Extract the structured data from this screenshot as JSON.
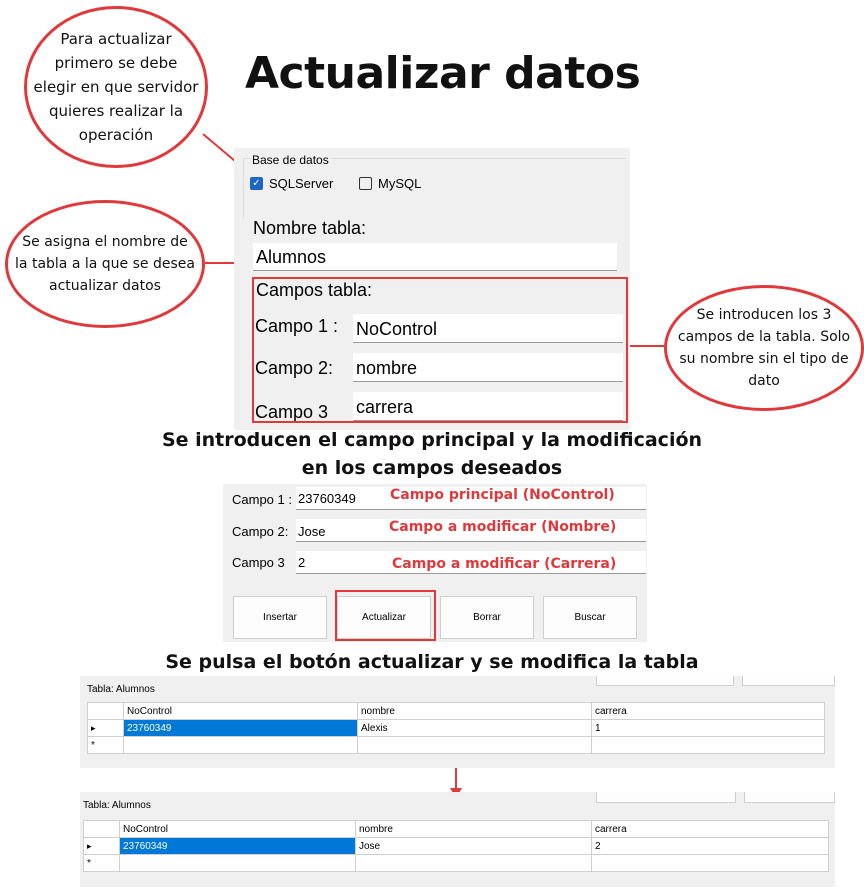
{
  "title": "Actualizar datos",
  "bubbles": {
    "server": "Para actualizar primero se debe elegir en que servidor quieres realizar la operación",
    "table": "Se asigna el nombre de la tabla a la que se desea actualizar datos",
    "fields": "Se introducen los 3 campos de la tabla. Solo su nombre sin el tipo de dato"
  },
  "form1": {
    "group_label": "Base de datos",
    "sqlserver": "SQLServer",
    "mysql": "MySQL",
    "nombre_tabla_label": "Nombre tabla:",
    "nombre_tabla_value": "Alumnos",
    "campos_label": "Campos tabla:",
    "campo1_label": "Campo 1 :",
    "campo1_value": "NoControl",
    "campo2_label": "Campo 2:",
    "campo2_value": "nombre",
    "campo3_label": "Campo 3",
    "campo3_value": "carrera"
  },
  "heading2": "Se introducen el campo principal y la modificación en los campos deseados",
  "form2": {
    "campo1_label": "Campo 1 :",
    "campo1_value": "23760349",
    "campo1_note": "Campo principal (NoControl)",
    "campo2_label": "Campo 2:",
    "campo2_value": "Jose",
    "campo2_note": "Campo a modificar (Nombre)",
    "campo3_label": "Campo 3",
    "campo3_value": "2",
    "campo3_note": "Campo a modificar (Carrera)",
    "buttons": [
      "Insertar",
      "Actualizar",
      "Borrar",
      "Buscar"
    ]
  },
  "heading3": "Se pulsa el botón actualizar y se modifica la tabla",
  "table_before": {
    "label": "Tabla: Alumnos",
    "columns": [
      "NoControl",
      "nombre",
      "carrera"
    ],
    "row": [
      "23760349",
      "Alexis",
      "1"
    ],
    "row_marker": "▸",
    "new_marker": "*"
  },
  "table_after": {
    "label": "Tabla: Alumnos",
    "columns": [
      "NoControl",
      "nombre",
      "carrera"
    ],
    "row": [
      "23760349",
      "Jose",
      "2"
    ],
    "row_marker": "▸",
    "new_marker": "*"
  },
  "colors": {
    "accent_red": "#e0393c",
    "select_blue": "#0078d7"
  }
}
